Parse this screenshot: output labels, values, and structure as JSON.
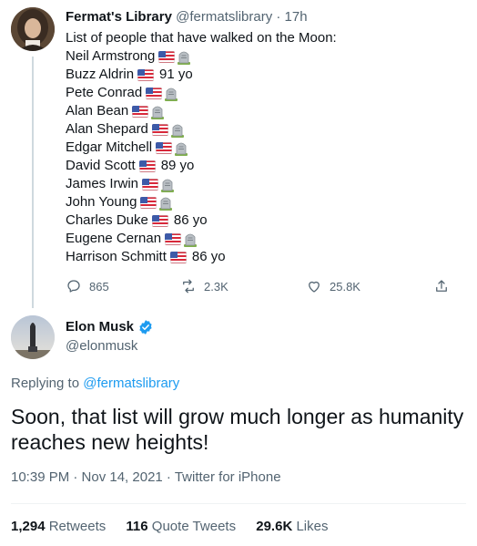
{
  "parent": {
    "name": "Fermat's Library",
    "handle": "@fermatslibrary",
    "separator": "·",
    "time": "17h",
    "intro": "List of people that have walked on the Moon:",
    "astronauts": [
      {
        "name": "Neil Armstrong",
        "status": "deceased",
        "age": ""
      },
      {
        "name": "Buzz Aldrin",
        "status": "alive",
        "age": "91 yo"
      },
      {
        "name": "Pete Conrad",
        "status": "deceased",
        "age": ""
      },
      {
        "name": "Alan Bean",
        "status": "deceased",
        "age": ""
      },
      {
        "name": "Alan Shepard",
        "status": "deceased",
        "age": ""
      },
      {
        "name": "Edgar Mitchell",
        "status": "deceased",
        "age": ""
      },
      {
        "name": "David Scott",
        "status": "alive",
        "age": "89 yo"
      },
      {
        "name": "James Irwin",
        "status": "deceased",
        "age": ""
      },
      {
        "name": "John Young",
        "status": "deceased",
        "age": ""
      },
      {
        "name": "Charles Duke",
        "status": "alive",
        "age": "86 yo"
      },
      {
        "name": "Eugene Cernan",
        "status": "deceased",
        "age": ""
      },
      {
        "name": "Harrison Schmitt",
        "status": "alive",
        "age": "86 yo"
      }
    ],
    "actions": {
      "replies": "865",
      "retweets": "2.3K",
      "likes": "25.8K"
    },
    "icons": {
      "flag": "us-flag-icon",
      "deceased": "headstone-icon",
      "reply": "reply-icon",
      "retweet": "retweet-icon",
      "like": "heart-icon",
      "share": "share-icon"
    }
  },
  "reply": {
    "name": "Elon Musk",
    "handle": "@elonmusk",
    "verified_icon": "verified-badge-icon",
    "replying_prefix": "Replying to",
    "replying_handle": "@fermatslibrary",
    "text": "Soon, that list will grow much longer as humanity reaches new heights!",
    "timestamp": "10:39 PM · Nov 14, 2021 · Twitter for iPhone",
    "stats": {
      "retweets_count": "1,294",
      "retweets_label": "Retweets",
      "quotes_count": "116",
      "quotes_label": "Quote Tweets",
      "likes_count": "29.6K",
      "likes_label": "Likes"
    }
  },
  "colors": {
    "text": "#0f1419",
    "secondary": "#536471",
    "accent": "#1d9bf0",
    "thread_line": "#cfd9de",
    "divider": "#eff3f4"
  }
}
